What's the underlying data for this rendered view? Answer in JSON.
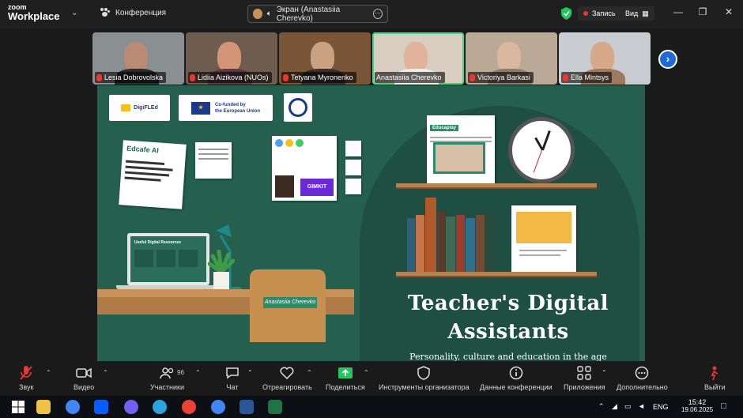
{
  "app": {
    "logo_line1": "zoom",
    "logo_line2": "Workplace",
    "meeting_title": "Конференция",
    "share_label": "Экран (Anastasiia Cherevko)",
    "record_label": "Запись",
    "view_label": "Вид",
    "accent_color": "#3ddc84",
    "record_color": "#e53935"
  },
  "participants": [
    {
      "name": "Lesia Dobrovolska",
      "muted": true
    },
    {
      "name": "Lidiia Aizikova (NUOs)",
      "muted": true
    },
    {
      "name": "Tetyana Myronenko",
      "muted": true
    },
    {
      "name": "Anastasiia Cherevko",
      "muted": false,
      "active": true
    },
    {
      "name": "Victoriya Barkasi",
      "muted": true
    },
    {
      "name": "Ella Mintsys",
      "muted": true
    }
  ],
  "slide": {
    "title_line1": "Teacher's Digital",
    "title_line2": "Assistants",
    "subtitle": "Personality, culture and education in the age",
    "logo_digifled": "DigiFLEd",
    "logo_eu_line1": "Co-funded by",
    "logo_eu_line2": "the European Union",
    "edcafe": "Edcafe AI",
    "gimkit": "GIMKIT",
    "useful": "Useful Digital Resources",
    "chair_tag": "Anastasiia Cherevko",
    "educaplay": "Educaplay"
  },
  "toolbar": {
    "sound": "Звук",
    "video": "Видео",
    "participants": "Участники",
    "participants_count": "96",
    "chat": "Чат",
    "react": "Отреагировать",
    "share": "Поделиться",
    "host_tools": "Инструменты организатора",
    "conf_data": "Данные конференции",
    "apps": "Приложения",
    "more": "Дополнительно",
    "leave": "Выйти"
  },
  "taskbar": {
    "lang": "ENG",
    "time": "15:42",
    "date": "19.06.2025"
  }
}
